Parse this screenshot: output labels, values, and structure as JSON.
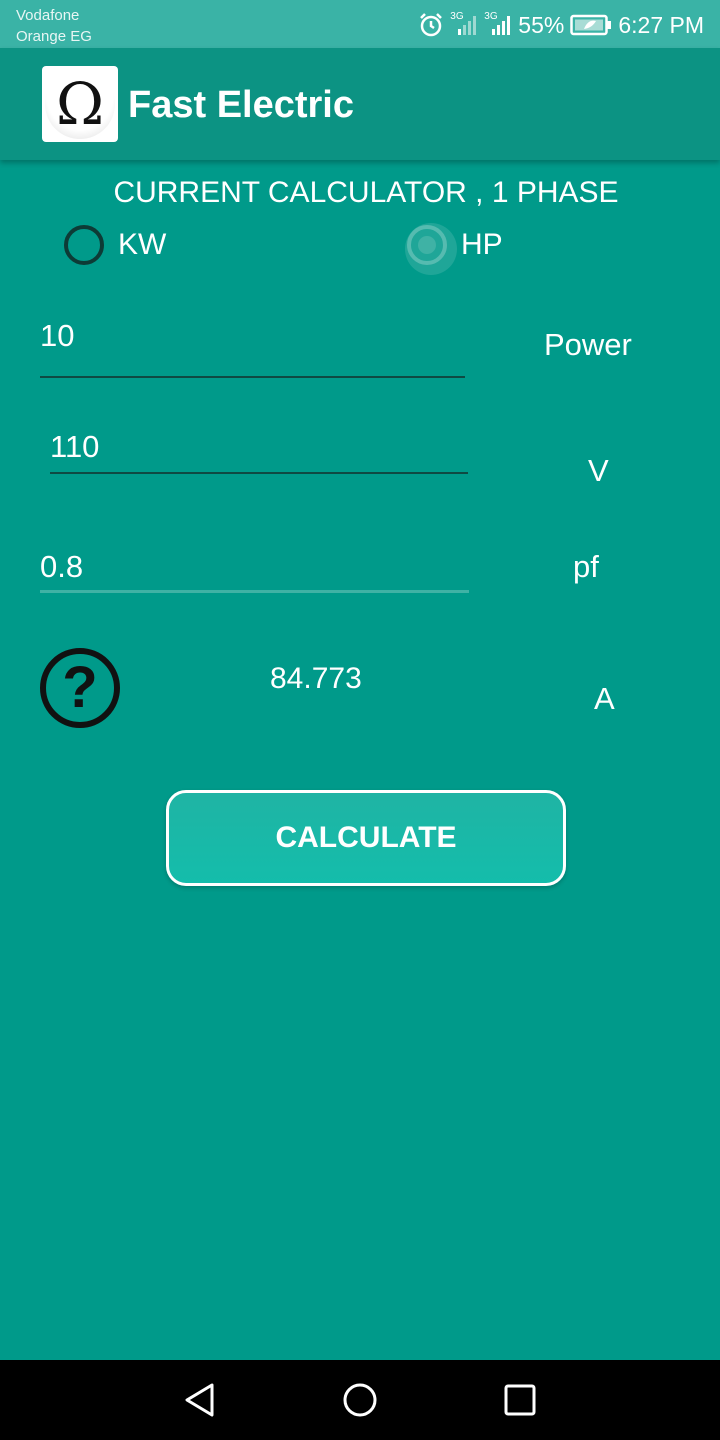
{
  "status": {
    "carrier_1": "Vodafone",
    "carrier_2": "Orange EG",
    "net_1": "3G",
    "net_2": "3G",
    "battery": "55%",
    "time": "6:27 PM"
  },
  "app": {
    "title": "Fast Electric",
    "logo_glyph": "Ω"
  },
  "calculator": {
    "heading": "CURRENT CALCULATOR , 1 PHASE",
    "radio_kw": "KW",
    "radio_hp": "HP",
    "selected": "HP",
    "power_value": "10",
    "power_unit": "Power",
    "voltage_value": "110",
    "voltage_unit": "V",
    "pf_value": "0.8",
    "pf_unit": "pf",
    "help_glyph": "?",
    "result_value": "84.773",
    "result_unit": "A",
    "button_label": "CALCULATE"
  },
  "colors": {
    "background": "#009a8a",
    "app_bar": "#0c9383",
    "status_bar": "#3ab3a6",
    "button": "#17b8a7"
  }
}
